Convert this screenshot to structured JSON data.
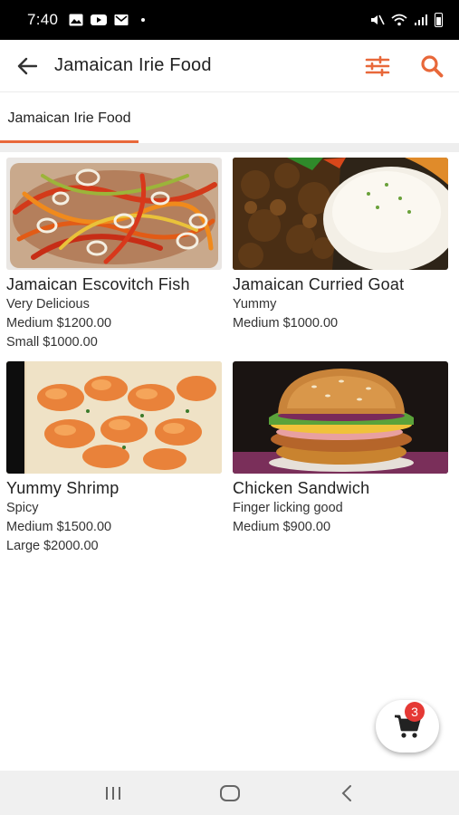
{
  "status_bar": {
    "time": "7:40",
    "notification_icons": [
      "image-icon",
      "youtube-icon",
      "email-icon"
    ]
  },
  "app_bar": {
    "title": "Jamaican Irie Food",
    "back_icon": "arrow-back-icon",
    "filter_icon": "sliders-icon",
    "search_icon": "search-icon",
    "accent_color": "#e8683a"
  },
  "tabs": [
    {
      "label": "Jamaican Irie Food",
      "selected": true
    }
  ],
  "products": [
    {
      "name": "Jamaican Escovitch Fish",
      "description": "Very Delicious",
      "prices": [
        "Medium $1200.00",
        "Small $1000.00"
      ]
    },
    {
      "name": "Jamaican Curried Goat",
      "description": "Yummy",
      "prices": [
        "Medium $1000.00"
      ]
    },
    {
      "name": "Yummy Shrimp",
      "description": "Spicy",
      "prices": [
        "Medium $1500.00",
        "Large $2000.00"
      ]
    },
    {
      "name": "Chicken Sandwich",
      "description": "Finger licking good",
      "prices": [
        "Medium $900.00"
      ]
    }
  ],
  "cart": {
    "count": "3",
    "icon": "cart-icon",
    "badge_color": "#e53935"
  },
  "nav_bar": {
    "icons": [
      "recent-apps-icon",
      "home-icon",
      "back-nav-icon"
    ]
  }
}
